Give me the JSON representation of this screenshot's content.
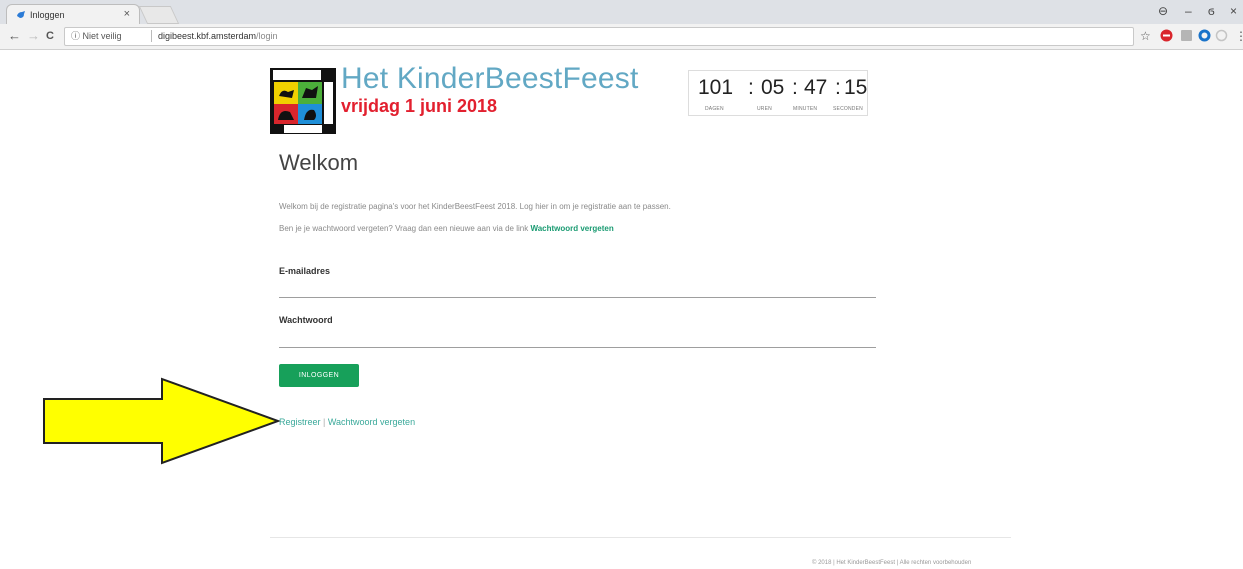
{
  "browser": {
    "tab_title": "Inloggen",
    "tab_close": "×",
    "security_label": "ⓘ Niet veilig",
    "url_host": "digibeest.kbf.amsterdam",
    "url_path": "/login",
    "nav_back": "←",
    "nav_forward": "→",
    "nav_reload": "C",
    "window_controls": {
      "account": "⊖",
      "minimize": "–",
      "restore": "ϭ",
      "close": "×"
    },
    "bookmark_star": "☆",
    "menu": "⋮"
  },
  "header": {
    "site_title": "Het KinderBeestFeest",
    "event_date": "vrijdag 1 juni 2018",
    "logo_icon": "kinderbeestfeest-logo"
  },
  "countdown": {
    "days": "101",
    "hours": "05",
    "minutes": "47",
    "seconds": "15",
    "separator": ":",
    "labels": {
      "days": "DAGEN",
      "hours": "UREN",
      "minutes": "MINUTEN",
      "seconds": "SECONDEN"
    }
  },
  "main": {
    "title": "Welkom",
    "intro_line1": "Welkom bij de registratie pagina's voor het KinderBeestFeest 2018. Log hier in om je registratie aan te passen.",
    "intro_line2_prefix": "Ben je je wachtwoord vergeten? Vraag dan een nieuwe aan via de link ",
    "intro_line2_link": "Wachtwoord vergeten"
  },
  "form": {
    "email_label": "E-mailadres",
    "email_value": "",
    "password_label": "Wachtwoord",
    "password_value": "",
    "login_button": "INLOGGEN"
  },
  "links": {
    "register": "Registreer",
    "separator": " | ",
    "forgot_password": "Wachtwoord vergeten"
  },
  "annotation": {
    "arrow_color": "#ffff00",
    "arrow_icon": "right-arrow"
  },
  "footer": {
    "text": "© 2018 | Het KinderBeestFeest | Alle rechten voorbehouden"
  },
  "colors": {
    "title_blue": "#62a8c4",
    "date_red": "#e2202f",
    "button_green": "#17a05a",
    "link_teal": "#3aa99a"
  }
}
